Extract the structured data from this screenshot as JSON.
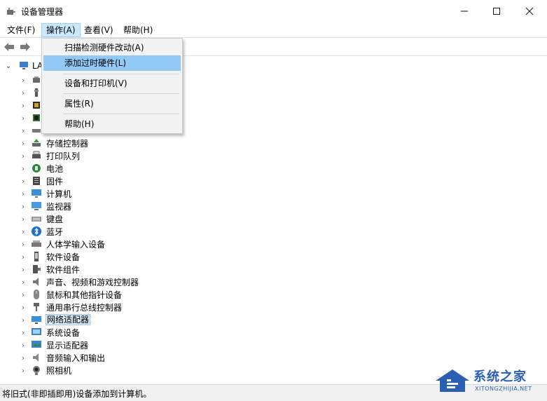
{
  "window": {
    "title": "设备管理器",
    "controls": {
      "minimize": "minimize",
      "maximize": "maximize",
      "close": "close"
    }
  },
  "menubar": {
    "items": [
      "文件(F)",
      "操作(A)",
      "查看(V)",
      "帮助(H)"
    ],
    "active_index": 1
  },
  "toolbar": {
    "buttons": [
      "back-arrow-icon",
      "forward-arrow-icon"
    ]
  },
  "dropdown": {
    "items": [
      {
        "label": "扫描检测硬件改动(A)",
        "highlighted": false
      },
      {
        "label": "添加过时硬件(L)",
        "highlighted": true
      },
      {
        "label": "设备和打印机(V)",
        "highlighted": false
      },
      {
        "label": "属性(R)",
        "highlighted": false
      },
      {
        "label": "帮助(H)",
        "highlighted": false
      }
    ]
  },
  "tree": {
    "root_label": "LA",
    "items": [
      {
        "label": "",
        "icon": "audio-device-icon"
      },
      {
        "label": "",
        "icon": "usb-icon"
      },
      {
        "label": "",
        "icon": "processor-icon"
      },
      {
        "label": "",
        "icon": "chip-icon"
      },
      {
        "label": "",
        "icon": "disk-drive-icon"
      },
      {
        "label": "存储控制器",
        "icon": "storage-controller-icon"
      },
      {
        "label": "打印队列",
        "icon": "printer-icon"
      },
      {
        "label": "电池",
        "icon": "battery-icon"
      },
      {
        "label": "固件",
        "icon": "firmware-icon"
      },
      {
        "label": "计算机",
        "icon": "computer-icon"
      },
      {
        "label": "监视器",
        "icon": "monitor-icon"
      },
      {
        "label": "键盘",
        "icon": "keyboard-icon"
      },
      {
        "label": "蓝牙",
        "icon": "bluetooth-icon"
      },
      {
        "label": "人体学输入设备",
        "icon": "hid-icon"
      },
      {
        "label": "软件设备",
        "icon": "software-device-icon"
      },
      {
        "label": "软件组件",
        "icon": "software-component-icon"
      },
      {
        "label": "声音、视频和游戏控制器",
        "icon": "speaker-icon"
      },
      {
        "label": "鼠标和其他指针设备",
        "icon": "mouse-icon"
      },
      {
        "label": "通用串行总线控制器",
        "icon": "usb-plug-icon"
      },
      {
        "label": "网络适配器",
        "icon": "network-adapter-icon",
        "selected": true
      },
      {
        "label": "系统设备",
        "icon": "system-device-icon"
      },
      {
        "label": "显示适配器",
        "icon": "display-adapter-icon"
      },
      {
        "label": "音频输入和输出",
        "icon": "audio-io-icon"
      },
      {
        "label": "照相机",
        "icon": "camera-icon"
      }
    ]
  },
  "statusbar": {
    "message": "将旧式(非即插即用)设备添加到计算机。"
  },
  "watermark": {
    "name": "系统之家",
    "url": "XITONGZHIJIA.NET"
  },
  "colors": {
    "menu_active_bg": "#cce8ff",
    "dropdown_highlight": "#91c9f7",
    "selection_bg": "#d9ebf9",
    "watermark_blue": "#2b5fb4"
  }
}
